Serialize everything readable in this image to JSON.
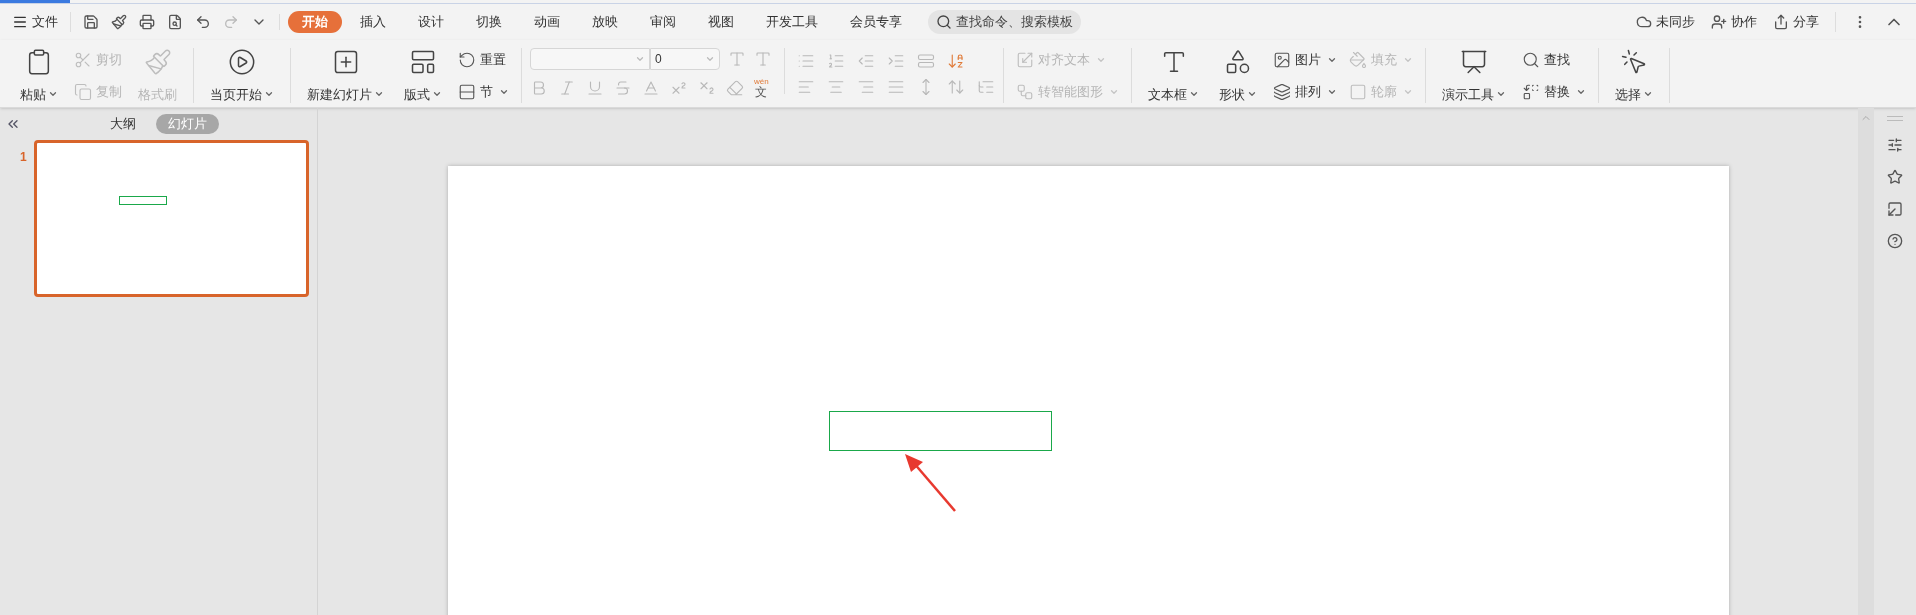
{
  "menu_bar": {
    "file_label": "文件",
    "tabs": [
      {
        "label": "开始",
        "selected": true
      },
      {
        "label": "插入",
        "selected": false
      },
      {
        "label": "设计",
        "selected": false
      },
      {
        "label": "切换",
        "selected": false
      },
      {
        "label": "动画",
        "selected": false
      },
      {
        "label": "放映",
        "selected": false
      },
      {
        "label": "审阅",
        "selected": false
      },
      {
        "label": "视图",
        "selected": false
      },
      {
        "label": "开发工具",
        "selected": false
      },
      {
        "label": "会员专享",
        "selected": false
      }
    ],
    "search": {
      "placeholder": "查找命令、搜索模板"
    },
    "actions": [
      "未同步",
      "协作",
      "分享"
    ]
  },
  "ribbon": {
    "groups": [
      {
        "columns": [
          {
            "kind": "large",
            "items": [
              {
                "label": "粘贴",
                "dropdown": true,
                "disabled": false
              }
            ]
          },
          {
            "kind": "stack",
            "items": [
              {
                "label": "剪切",
                "dropdown": false,
                "disabled": true
              },
              {
                "label": "复制",
                "dropdown": false,
                "disabled": true
              }
            ]
          },
          {
            "kind": "large",
            "items": [
              {
                "label": "格式刷",
                "dropdown": false,
                "disabled": true
              }
            ]
          }
        ]
      },
      {
        "columns": [
          {
            "kind": "large",
            "items": [
              {
                "label": "当页开始",
                "dropdown": true,
                "disabled": false
              }
            ]
          }
        ]
      },
      {
        "columns": [
          {
            "kind": "large",
            "items": [
              {
                "label": "新建幻灯片",
                "dropdown": true,
                "disabled": false
              }
            ]
          },
          {
            "kind": "large",
            "items": [
              {
                "label": "版式",
                "dropdown": true,
                "disabled": false
              }
            ]
          },
          {
            "kind": "stack",
            "items": [
              {
                "label": "重置",
                "dropdown": false,
                "disabled": false
              },
              {
                "label": "节",
                "dropdown": true,
                "disabled": false
              }
            ]
          }
        ]
      },
      {
        "kind": "font",
        "font_size": "0",
        "phonetic": {
          "pinyin": "wén",
          "char": "文"
        }
      },
      {
        "columns": [
          {
            "kind": "stack",
            "items": [
              {
                "label": "对齐文本",
                "dropdown": true,
                "disabled": true
              },
              {
                "label": "转智能图形",
                "dropdown": true,
                "disabled": true
              }
            ]
          }
        ]
      },
      {
        "columns": [
          {
            "kind": "large",
            "items": [
              {
                "label": "文本框",
                "dropdown": true,
                "disabled": false
              }
            ]
          },
          {
            "kind": "large",
            "items": [
              {
                "label": "形状",
                "dropdown": true,
                "disabled": false
              }
            ]
          },
          {
            "kind": "stack",
            "items": [
              {
                "label": "图片",
                "dropdown": true,
                "disabled": false
              },
              {
                "label": "排列",
                "dropdown": true,
                "disabled": false
              }
            ]
          },
          {
            "kind": "stack",
            "items": [
              {
                "label": "填充",
                "dropdown": true,
                "disabled": true
              },
              {
                "label": "轮廓",
                "dropdown": true,
                "disabled": true
              }
            ]
          }
        ]
      },
      {
        "columns": [
          {
            "kind": "large",
            "items": [
              {
                "label": "演示工具",
                "dropdown": true,
                "disabled": false
              }
            ]
          },
          {
            "kind": "stack",
            "items": [
              {
                "label": "查找",
                "dropdown": false,
                "disabled": false
              },
              {
                "label": "替换",
                "dropdown": true,
                "disabled": false
              }
            ]
          }
        ]
      },
      {
        "columns": [
          {
            "kind": "large",
            "items": [
              {
                "label": "选择",
                "dropdown": true,
                "disabled": false
              }
            ]
          }
        ]
      }
    ]
  },
  "side_panel": {
    "tabs": [
      {
        "label": "大纲",
        "selected": false
      },
      {
        "label": "幻灯片",
        "selected": true
      }
    ],
    "slides": [
      {
        "number": "1",
        "selected": true
      }
    ]
  }
}
